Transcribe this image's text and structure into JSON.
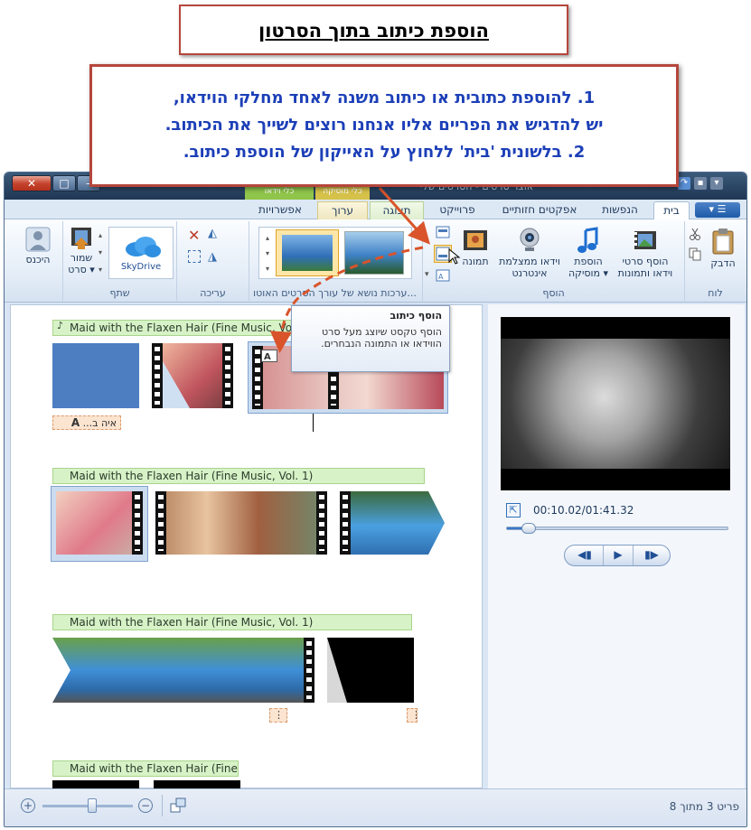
{
  "annotation": {
    "title": "הוספת כיתוב בתוך הסרטון",
    "instructions": [
      "1. להוספת כתובית או כיתוב משנה לאחד מחלקי הוידאו,",
      "יש להדגיש את הפריים אליו אנחנו רוצים לשייך את הכיתוב.",
      "2. בלשונית 'בית' ללחוץ על האייקון של הוספת כיתוב."
    ]
  },
  "window": {
    "title": "אוצר סרטים - הסרטים שלי",
    "contextual_headers": [
      "כלי וידאו",
      "כלי מוסיקה"
    ],
    "app_menu_label": "▾"
  },
  "tabs": [
    "בית",
    "הנפשות",
    "אפקטים חזותיים",
    "פרוייקט",
    "תצוגה",
    "ערוך",
    "אפשרויות"
  ],
  "ribbon": {
    "groups": {
      "clipboard": {
        "label": "לוח",
        "paste": "הדבק"
      },
      "add": {
        "label": "הוסף",
        "add_videos": "הוסף סרטי",
        "add_videos_2": "וידאו ותמונות",
        "add_music": "הוספת",
        "add_music_2": "מוסיקה ▾",
        "webcam": "וידאו ממצלמת",
        "webcam_2": "אינטרנט",
        "snapshot": "תמונה"
      },
      "themes": {
        "label": "ערכות נושא של עורך הסרטים האוטו..."
      },
      "editing": {
        "label": "עריכה"
      },
      "share": {
        "label": "שתף",
        "skydrive": "SkyDrive",
        "save_movie": "שמור",
        "save_movie_2": "סרט ▾"
      },
      "signin": {
        "label": "היכנס"
      }
    }
  },
  "tooltip": {
    "title": "הוסף כיתוב",
    "body": "הוסף טקסט שיוצג מעל סרט הווידאו או התמונה הנבחרים."
  },
  "storyboard": {
    "music_tracks": [
      "Maid with the Flaxen Hair (Fine Music, Vol. 1)",
      "Maid with the Flaxen Hair (Fine Music, Vol. 1)",
      "Maid with the Flaxen Hair (Fine Music, Vol. 1)",
      "Maid with the Flaxen Hair (Fine..."
    ],
    "caption_tag": "איה ב..."
  },
  "preview": {
    "timecode": "00:10.02/01:41.32",
    "seek_fraction": 0.1
  },
  "status": {
    "item_count": "פריט 3 מתוך 8",
    "zoom_fraction": 0.55
  },
  "colors": {
    "annotation_border": "#b5463c",
    "instruction_text": "#1c3fb8",
    "music_bar": "#d7f2c7",
    "title_clip": "#4e7ec2",
    "callout_arrow": "#d9542b"
  }
}
